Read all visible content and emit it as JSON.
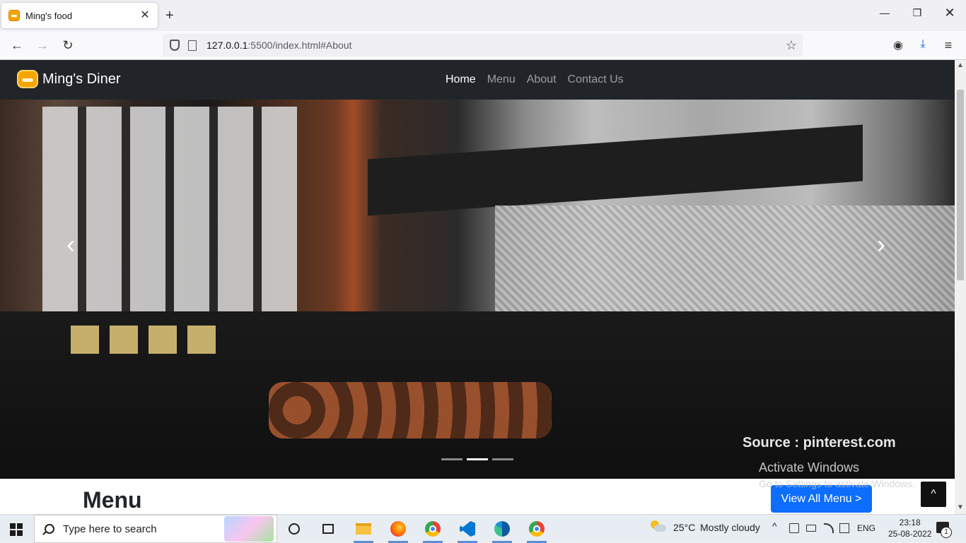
{
  "browser": {
    "tab_title": "Ming's food",
    "tab_close": "✕",
    "new_tab": "+",
    "url_host": "127.0.0.1",
    "url_rest": ":5500/index.html#About",
    "window_controls": {
      "minimize": "—",
      "maximize": "❐",
      "close": "✕"
    },
    "nav": {
      "back": "←",
      "forward": "→",
      "reload": "↻"
    },
    "icons": {
      "bookmark_star": "☆",
      "pocket": "pocket-icon",
      "downloads": "download-icon",
      "menu": "≡"
    }
  },
  "site": {
    "brand": "Ming's Diner",
    "nav_links": [
      {
        "label": "Home",
        "active": true
      },
      {
        "label": "Menu",
        "active": false
      },
      {
        "label": "About",
        "active": false
      },
      {
        "label": "Contact Us",
        "active": false
      }
    ],
    "carousel": {
      "prev": "‹",
      "next": "›",
      "image_caption": "Source : pinterest.com",
      "indicators": [
        false,
        true,
        false
      ]
    },
    "menu_heading": "Menu",
    "view_all_button": "View All Menu >",
    "back_to_top": "^"
  },
  "watermark": {
    "line1": "Activate Windows",
    "line2": "Go to Settings to activate Windows."
  },
  "taskbar": {
    "search_placeholder": "Type here to search",
    "weather_temp": "25°C",
    "weather_condition": "Mostly cloudy",
    "tray_chevron": "^",
    "language": "ENG",
    "time": "23:18",
    "date": "25-08-2022",
    "notification_count": "1"
  }
}
